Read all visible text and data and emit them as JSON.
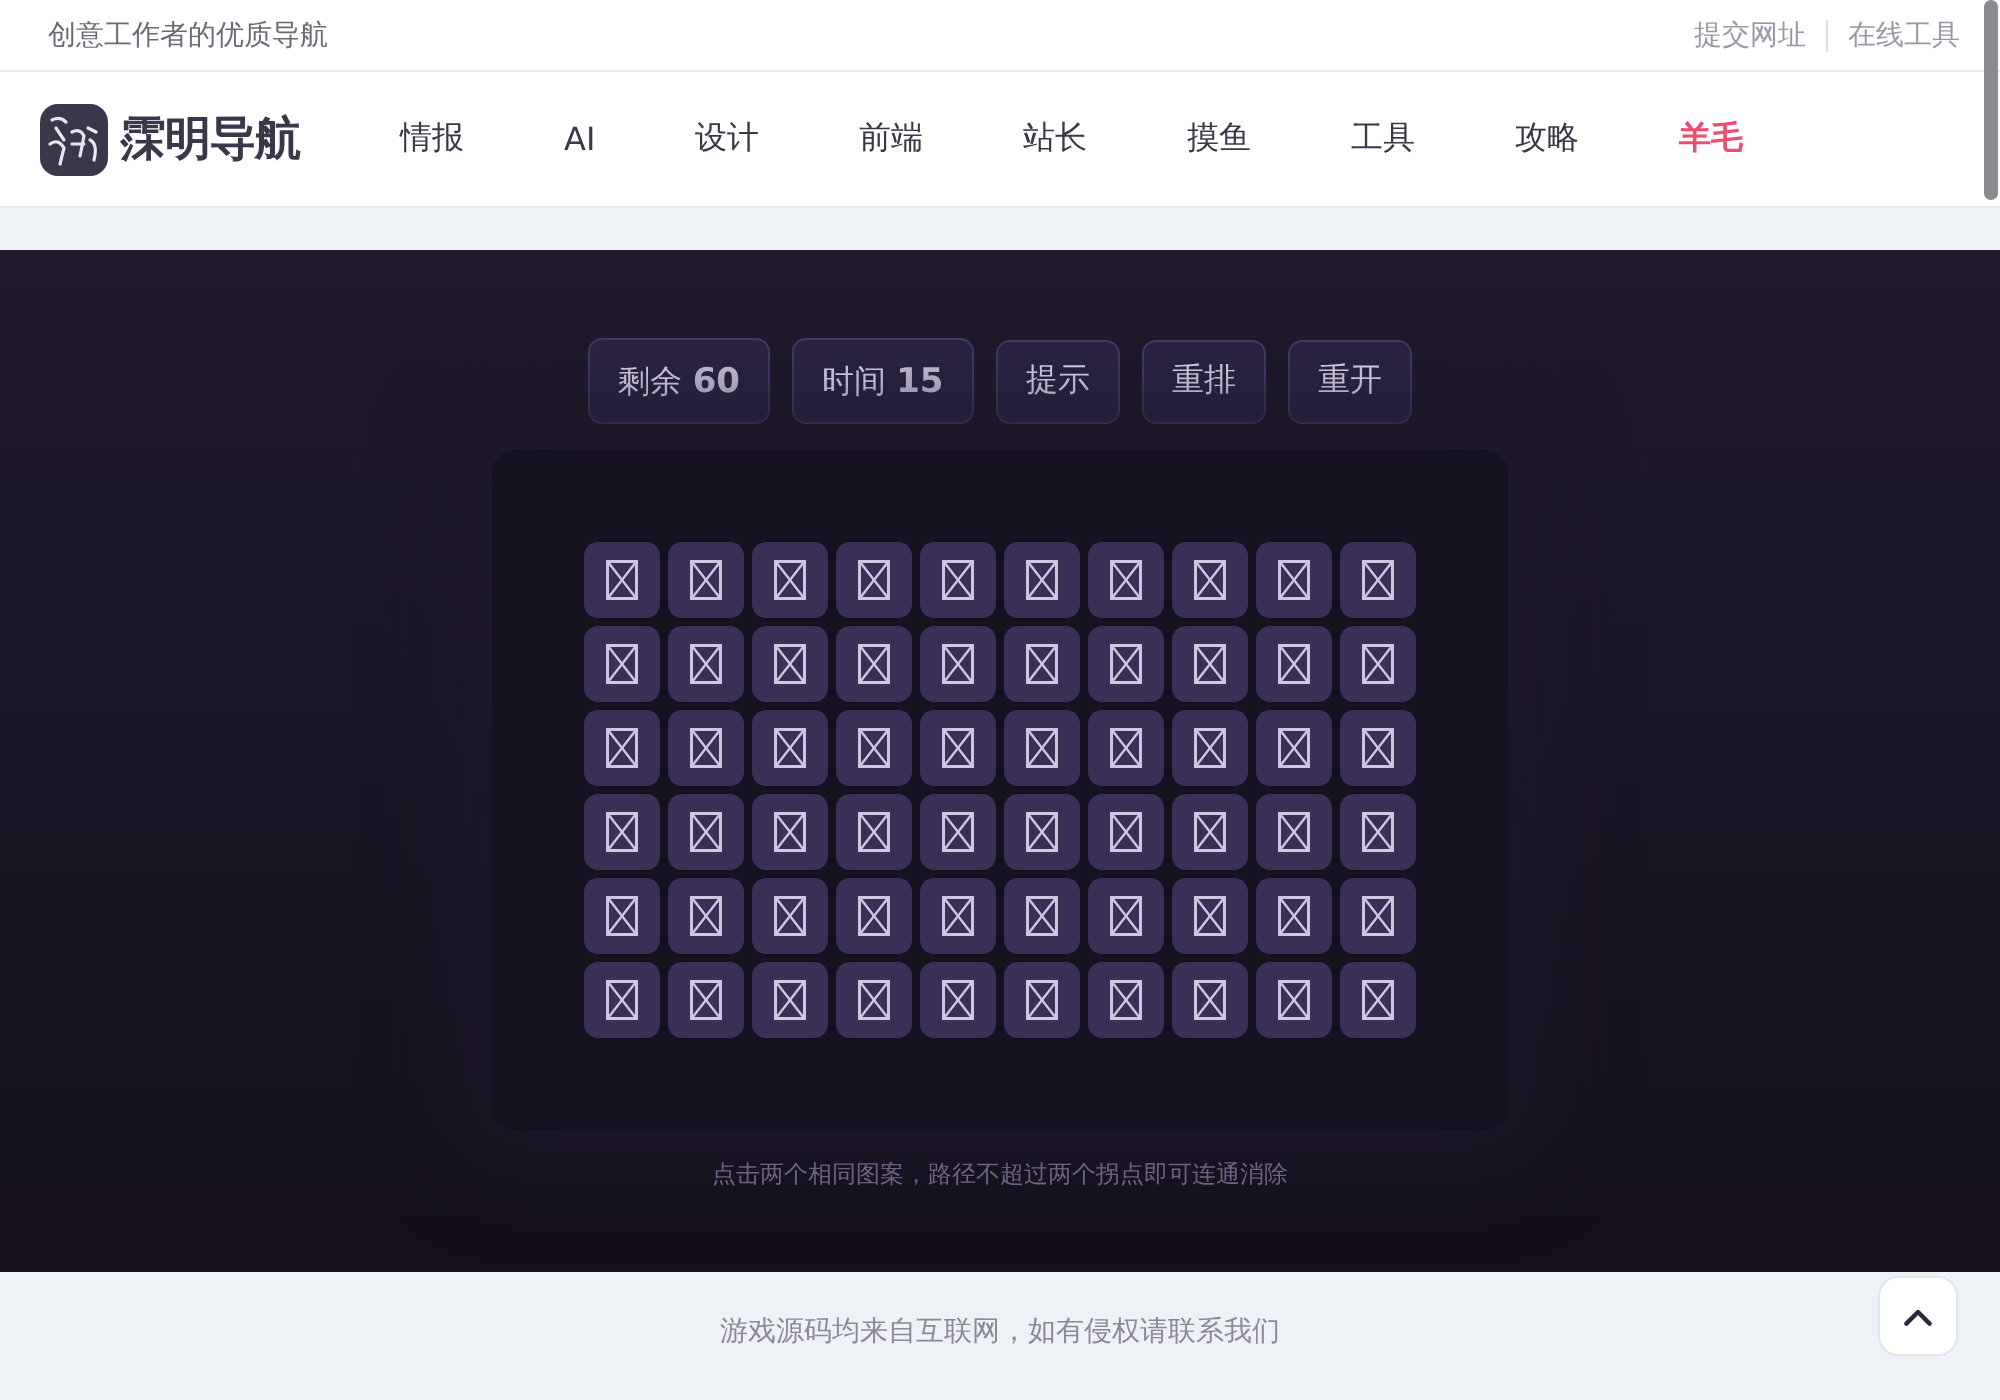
{
  "top_bar": {
    "tagline": "创意工作者的优质导航",
    "links": [
      "提交网址",
      "在线工具"
    ]
  },
  "nav": {
    "logo_text": "霂明导航",
    "items": [
      {
        "label": "情报",
        "highlight": false
      },
      {
        "label": "AI",
        "highlight": false
      },
      {
        "label": "设计",
        "highlight": false
      },
      {
        "label": "前端",
        "highlight": false
      },
      {
        "label": "站长",
        "highlight": false
      },
      {
        "label": "摸鱼",
        "highlight": false
      },
      {
        "label": "工具",
        "highlight": false
      },
      {
        "label": "攻略",
        "highlight": false
      },
      {
        "label": "羊毛",
        "highlight": true
      }
    ]
  },
  "game": {
    "stats": [
      "剩余 **60**",
      "时间 **15**"
    ],
    "actions": [
      "提示",
      "重排",
      "重开"
    ],
    "board": {
      "rows": [
        {
          "tiles": [
            {
              "kind": "broken-image"
            },
            {
              "kind": "broken-image"
            },
            {
              "kind": "broken-image"
            },
            {
              "kind": "broken-image"
            },
            {
              "kind": "broken-image"
            },
            {
              "kind": "broken-image"
            },
            {
              "kind": "broken-image"
            },
            {
              "kind": "broken-image"
            },
            {
              "kind": "broken-image"
            },
            {
              "kind": "broken-image"
            }
          ]
        },
        {
          "tiles": [
            {
              "kind": "broken-image"
            },
            {
              "kind": "broken-image"
            },
            {
              "kind": "broken-image"
            },
            {
              "kind": "broken-image"
            },
            {
              "kind": "broken-image"
            },
            {
              "kind": "broken-image"
            },
            {
              "kind": "broken-image"
            },
            {
              "kind": "broken-image"
            },
            {
              "kind": "broken-image"
            },
            {
              "kind": "broken-image"
            }
          ]
        },
        {
          "tiles": [
            {
              "kind": "broken-image"
            },
            {
              "kind": "broken-image"
            },
            {
              "kind": "broken-image"
            },
            {
              "kind": "broken-image"
            },
            {
              "kind": "broken-image"
            },
            {
              "kind": "broken-image"
            },
            {
              "kind": "broken-image"
            },
            {
              "kind": "broken-image"
            },
            {
              "kind": "broken-image"
            },
            {
              "kind": "broken-image"
            }
          ]
        },
        {
          "tiles": [
            {
              "kind": "broken-image"
            },
            {
              "kind": "broken-image"
            },
            {
              "kind": "broken-image"
            },
            {
              "kind": "broken-image"
            },
            {
              "kind": "broken-image"
            },
            {
              "kind": "broken-image"
            },
            {
              "kind": "broken-image"
            },
            {
              "kind": "broken-image"
            },
            {
              "kind": "broken-image"
            },
            {
              "kind": "broken-image"
            }
          ]
        },
        {
          "tiles": [
            {
              "kind": "broken-image"
            },
            {
              "kind": "broken-image"
            },
            {
              "kind": "broken-image"
            },
            {
              "kind": "broken-image"
            },
            {
              "kind": "broken-image"
            },
            {
              "kind": "broken-image"
            },
            {
              "kind": "broken-image"
            },
            {
              "kind": "broken-image"
            },
            {
              "kind": "broken-image"
            },
            {
              "kind": "broken-image"
            }
          ]
        },
        {
          "tiles": [
            {
              "kind": "broken-image"
            },
            {
              "kind": "broken-image"
            },
            {
              "kind": "broken-image"
            },
            {
              "kind": "broken-image"
            },
            {
              "kind": "broken-image"
            },
            {
              "kind": "broken-image"
            },
            {
              "kind": "broken-image"
            },
            {
              "kind": "broken-image"
            },
            {
              "kind": "broken-image"
            },
            {
              "kind": "broken-image"
            }
          ]
        }
      ]
    },
    "hint": "点击两个相同图案，路径不超过两个拐点即可连通消除"
  },
  "footer": {
    "notice": "游戏源码均来自互联网，如有侵权请联系我们"
  }
}
